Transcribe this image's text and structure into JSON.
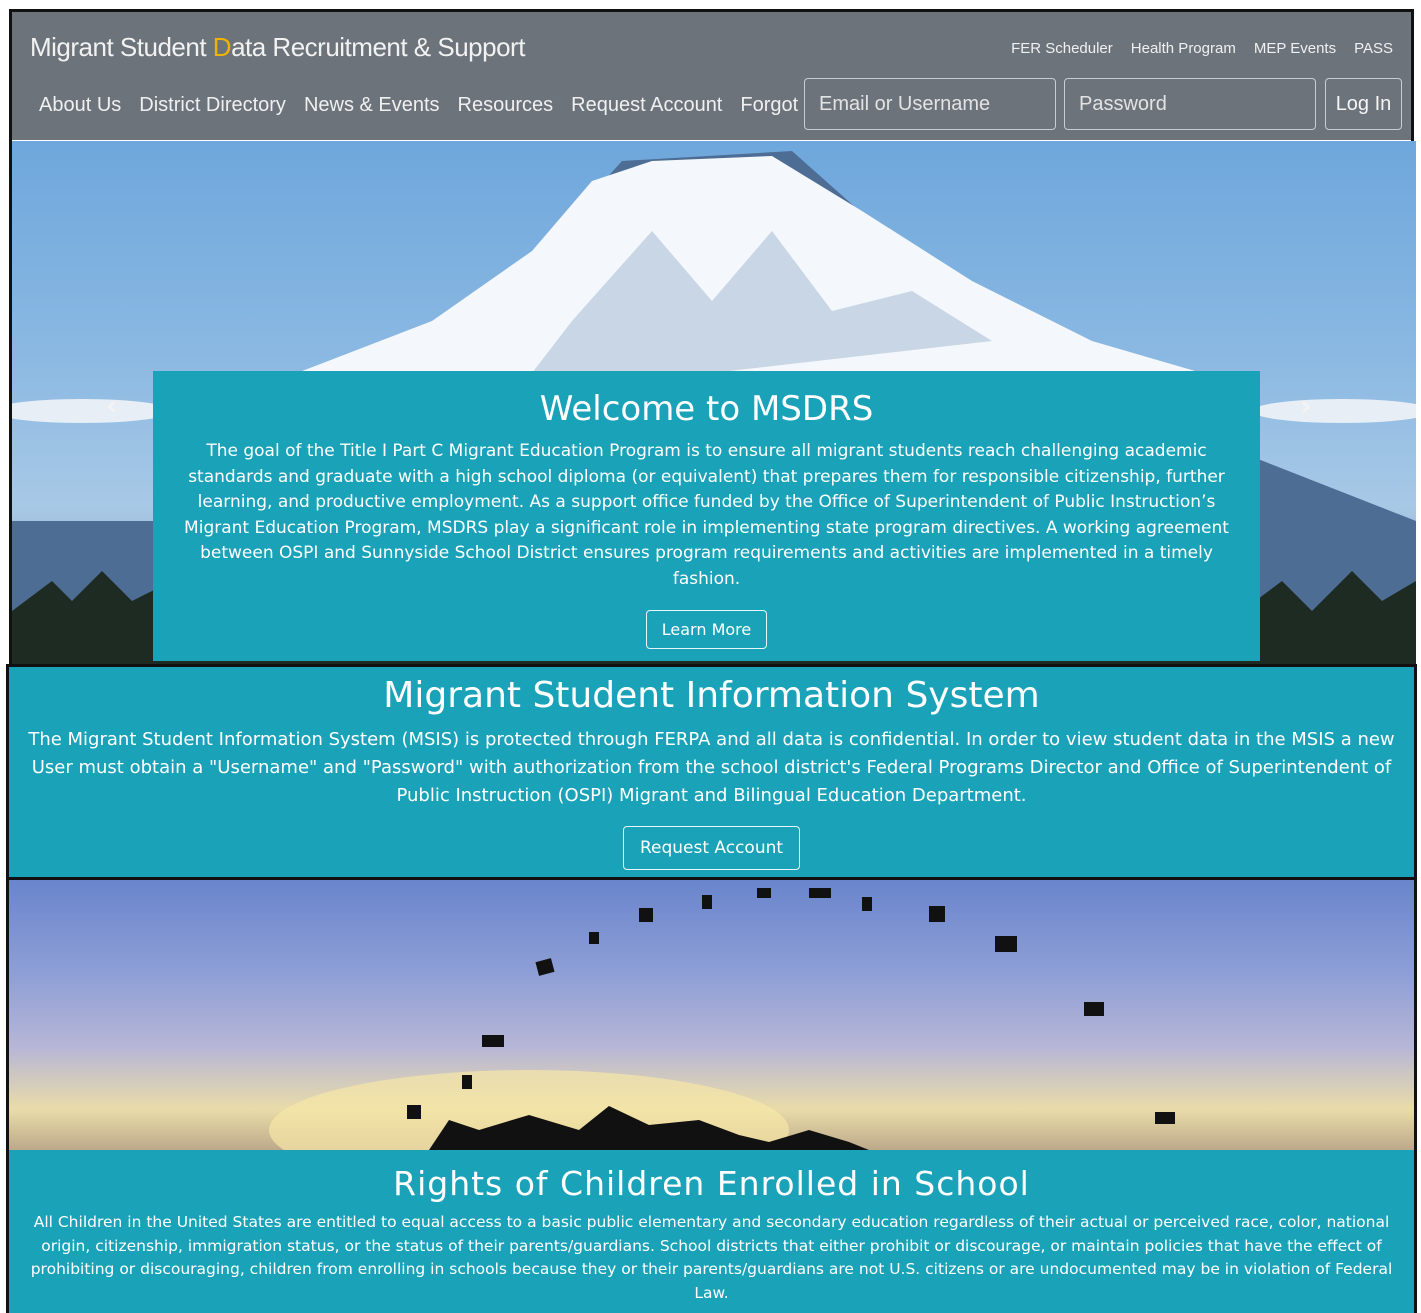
{
  "header": {
    "brand_pre": "Migrant Student ",
    "brand_d": "D",
    "brand_post": "ata Recruitment & Support",
    "top_links": [
      "FER Scheduler",
      "Health Program",
      "MEP Events",
      "PASS"
    ],
    "nav": [
      "About Us",
      "District Directory",
      "News & Events",
      "Resources",
      "Request Account",
      "Forgot Password"
    ],
    "email_placeholder": "Email or Username",
    "password_placeholder": "Password",
    "login_label": "Log In"
  },
  "hero": {
    "prev_icon": "‹",
    "next_icon": "›",
    "title": "Welcome to MSDRS",
    "body": "The goal of the Title I Part C Migrant Education Program is to ensure all migrant students reach challenging academic standards and graduate with a high school diploma (or equivalent) that prepares them for responsible citizenship, further learning, and productive employment. As a support office funded by the Office of Superintendent of Public Instruction’s Migrant Education Program, MSDRS play a significant role in implementing state program directives. A working agreement between OSPI and Sunnyside School District ensures program requirements and activities are implemented in a timely fashion.",
    "button": "Learn More"
  },
  "msis": {
    "title": "Migrant Student Information System",
    "body": "The Migrant Student Information System (MSIS) is protected through FERPA and all data is confidential. In order to view student data in the MSIS a new User must obtain a \"Username\" and \"Password\" with authorization from the school district's Federal Programs Director and Office of Superintendent of Public Instruction (OSPI) Migrant and Bilingual Education Department.",
    "button": "Request Account"
  },
  "rights": {
    "title": "Rights of Children Enrolled in School",
    "body": "All Children in the United States are entitled to equal access to a basic public elementary and secondary education regardless of their actual or perceived race, color, national origin, citizenship, immigration status, or the status of their parents/guardians. School districts that either prohibit or discourage, or maintain policies that have the effect of prohibiting or discouraging, children from enrolling in schools because they or their parents/guardians are not U.S. citizens or are undocumented may be in violation of Federal Law."
  }
}
